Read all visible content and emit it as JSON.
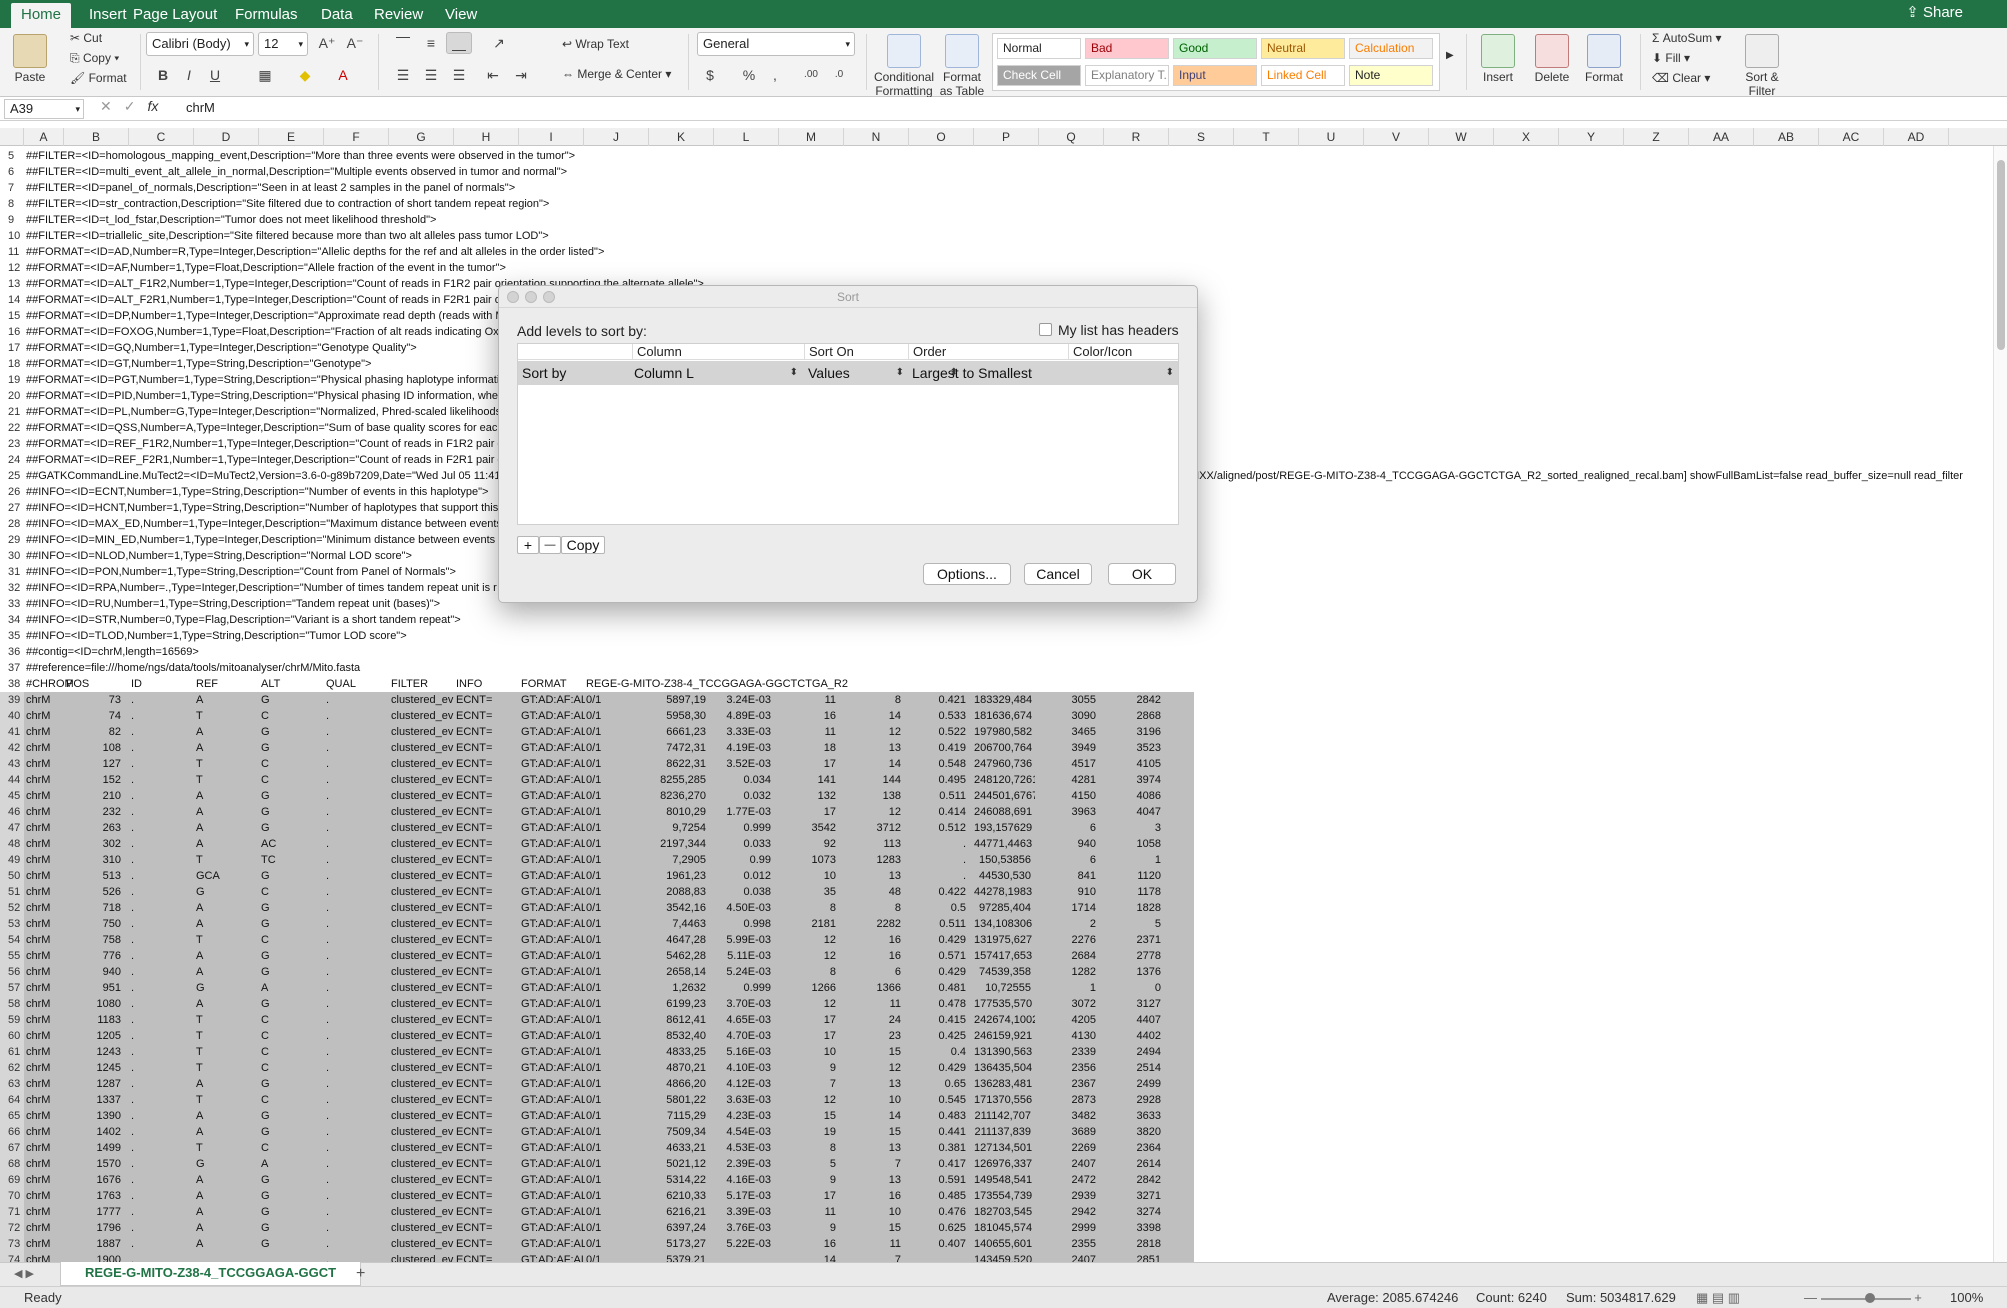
{
  "tabs": [
    "Home",
    "Insert",
    "Page Layout",
    "Formulas",
    "Data",
    "Review",
    "View"
  ],
  "share": "Share",
  "ribbon": {
    "paste": "Paste",
    "cut": "Cut",
    "copy": "Copy",
    "format": "Format",
    "font": "Calibri (Body)",
    "size": "12",
    "bold": "B",
    "italic": "I",
    "underline": "U",
    "wrap": "Wrap Text",
    "merge": "Merge & Center",
    "numfmt": "General",
    "cond": [
      "Conditional",
      "Formatting"
    ],
    "fat": [
      "Format",
      "as Table"
    ],
    "styles": [
      {
        "label": "Normal",
        "bg": "#ffffff",
        "fg": "#222222"
      },
      {
        "label": "Bad",
        "bg": "#ffc7ce",
        "fg": "#9c0006"
      },
      {
        "label": "Good",
        "bg": "#c6efce",
        "fg": "#006100"
      },
      {
        "label": "Neutral",
        "bg": "#ffeb9c",
        "fg": "#9c5700"
      },
      {
        "label": "Calculation",
        "bg": "#f2f2f2",
        "fg": "#fa7d00"
      },
      {
        "label": "Check Cell",
        "bg": "#a5a5a5",
        "fg": "#ffffff"
      },
      {
        "label": "Explanatory T...",
        "bg": "#ffffff",
        "fg": "#7f7f7f"
      },
      {
        "label": "Input",
        "bg": "#ffcc99",
        "fg": "#3f3f76"
      },
      {
        "label": "Linked Cell",
        "bg": "#ffffff",
        "fg": "#fa7d00"
      },
      {
        "label": "Note",
        "bg": "#ffffcc",
        "fg": "#222222"
      }
    ],
    "insert": "Insert",
    "delete": "Delete",
    "formatcells": "Format",
    "autosum": "AutoSum",
    "fill": "Fill",
    "clear": "Clear",
    "sortfilter": [
      "Sort &",
      "Filter"
    ]
  },
  "namebox": "A39",
  "fx": "fx",
  "formula": "chrM",
  "columns": [
    "A",
    "B",
    "C",
    "D",
    "E",
    "F",
    "G",
    "H",
    "I",
    "J",
    "K",
    "L",
    "M",
    "N",
    "O",
    "P",
    "Q",
    "R",
    "S",
    "T",
    "U",
    "V",
    "W",
    "X",
    "Y",
    "Z",
    "AA",
    "AB",
    "AC",
    "AD"
  ],
  "header_lines": [
    {
      "n": "5",
      "t": "##FILTER=<ID=homologous_mapping_event,Description=\"More than three events were observed in the tumor\">"
    },
    {
      "n": "6",
      "t": "##FILTER=<ID=multi_event_alt_allele_in_normal,Description=\"Multiple events observed in tumor and normal\">"
    },
    {
      "n": "7",
      "t": "##FILTER=<ID=panel_of_normals,Description=\"Seen in at least 2 samples in the panel of normals\">"
    },
    {
      "n": "8",
      "t": "##FILTER=<ID=str_contraction,Description=\"Site filtered due to contraction of short tandem repeat region\">"
    },
    {
      "n": "9",
      "t": "##FILTER=<ID=t_lod_fstar,Description=\"Tumor does not meet likelihood threshold\">"
    },
    {
      "n": "10",
      "t": "##FILTER=<ID=triallelic_site,Description=\"Site filtered because more than two alt alleles pass tumor LOD\">"
    },
    {
      "n": "11",
      "t": "##FORMAT=<ID=AD,Number=R,Type=Integer,Description=\"Allelic depths for the ref and alt alleles in the order listed\">"
    },
    {
      "n": "12",
      "t": "##FORMAT=<ID=AF,Number=1,Type=Float,Description=\"Allele fraction of the event in the tumor\">"
    },
    {
      "n": "13",
      "t": "##FORMAT=<ID=ALT_F1R2,Number=1,Type=Integer,Description=\"Count of reads in F1R2 pair orientation supporting the alternate allele\">"
    },
    {
      "n": "14",
      "t": "##FORMAT=<ID=ALT_F2R1,Number=1,Type=Integer,Description=\"Count of reads in F2R1 pair or"
    },
    {
      "n": "15",
      "t": "##FORMAT=<ID=DP,Number=1,Type=Integer,Description=\"Approximate read depth (reads with M"
    },
    {
      "n": "16",
      "t": "##FORMAT=<ID=FOXOG,Number=1,Type=Float,Description=\"Fraction of alt reads indicating Oxo"
    },
    {
      "n": "17",
      "t": "##FORMAT=<ID=GQ,Number=1,Type=Integer,Description=\"Genotype Quality\">"
    },
    {
      "n": "18",
      "t": "##FORMAT=<ID=GT,Number=1,Type=String,Description=\"Genotype\">"
    },
    {
      "n": "19",
      "t": "##FORMAT=<ID=PGT,Number=1,Type=String,Description=\"Physical phasing haplotype informati"
    },
    {
      "n": "20",
      "t": "##FORMAT=<ID=PID,Number=1,Type=String,Description=\"Physical phasing ID information, wher"
    },
    {
      "n": "21",
      "t": "##FORMAT=<ID=PL,Number=G,Type=Integer,Description=\"Normalized, Phred-scaled likelihoods"
    },
    {
      "n": "22",
      "t": "##FORMAT=<ID=QSS,Number=A,Type=Integer,Description=\"Sum of base quality scores for each"
    },
    {
      "n": "23",
      "t": "##FORMAT=<ID=REF_F1R2,Number=1,Type=Integer,Description=\"Count of reads in F1R2 pair or"
    },
    {
      "n": "24",
      "t": "##FORMAT=<ID=REF_F2R1,Number=1,Type=Integer,Description=\"Count of reads in F2R1 pair or"
    },
    {
      "n": "25",
      "t": "##GATKCommandLine.MuTect2=<ID=MuTect2,Version=3.6-0-g89b7209,Date=\"Wed Jul 05 11:41:"
    },
    {
      "n": "26",
      "t": "##INFO=<ID=ECNT,Number=1,Type=String,Description=\"Number of events in this haplotype\">"
    },
    {
      "n": "27",
      "t": "##INFO=<ID=HCNT,Number=1,Type=String,Description=\"Number of haplotypes that support this"
    },
    {
      "n": "28",
      "t": "##INFO=<ID=MAX_ED,Number=1,Type=Integer,Description=\"Maximum distance between events"
    },
    {
      "n": "29",
      "t": "##INFO=<ID=MIN_ED,Number=1,Type=Integer,Description=\"Minimum distance between events"
    },
    {
      "n": "30",
      "t": "##INFO=<ID=NLOD,Number=1,Type=String,Description=\"Normal LOD score\">"
    },
    {
      "n": "31",
      "t": "##INFO=<ID=PON,Number=1,Type=String,Description=\"Count from Panel of Normals\">"
    },
    {
      "n": "32",
      "t": "##INFO=<ID=RPA,Number=.,Type=Integer,Description=\"Number of times tandem repeat unit is r"
    },
    {
      "n": "33",
      "t": "##INFO=<ID=RU,Number=1,Type=String,Description=\"Tandem repeat unit (bases)\">"
    },
    {
      "n": "34",
      "t": "##INFO=<ID=STR,Number=0,Type=Flag,Description=\"Variant is a short tandem repeat\">"
    },
    {
      "n": "35",
      "t": "##INFO=<ID=TLOD,Number=1,Type=String,Description=\"Tumor LOD score\">"
    },
    {
      "n": "36",
      "t": "##contig=<ID=chrM,length=16569>"
    },
    {
      "n": "37",
      "t": "##reference=file:///home/ngs/data/tools/mitoanalyser/chrM/Mito.fasta"
    }
  ],
  "row25_tail": "ACB9CMANXX/aligned/post/REGE-G-MITO-Z38-4_TCCGGAGA-GGCTCTGA_R2_sorted_realigned_recal.bam] showFullBamList=false read_buffer_size=null read_filter",
  "table_header": {
    "n": "38",
    "cells": [
      "#CHROM",
      "POS",
      "ID",
      "REF",
      "ALT",
      "QUAL",
      "FILTER",
      "INFO",
      "FORMAT",
      "REGE-G-MITO-Z38-4_TCCGGAGA-GGCTCTGA_R2"
    ]
  },
  "rows": [
    {
      "n": "39",
      "pos": "73",
      "ref": "A",
      "alt": "G",
      "j": "5897,19",
      "k": "3.24E-03",
      "l": "11",
      "m": "8",
      "n2": "0.421",
      "o": "183329,484",
      "p": "3055",
      "q": "2842"
    },
    {
      "n": "40",
      "pos": "74",
      "ref": "T",
      "alt": "C",
      "j": "5958,30",
      "k": "4.89E-03",
      "l": "16",
      "m": "14",
      "n2": "0.533",
      "o": "181636,674",
      "p": "3090",
      "q": "2868"
    },
    {
      "n": "41",
      "pos": "82",
      "ref": "A",
      "alt": "G",
      "j": "6661,23",
      "k": "3.33E-03",
      "l": "11",
      "m": "12",
      "n2": "0.522",
      "o": "197980,582",
      "p": "3465",
      "q": "3196"
    },
    {
      "n": "42",
      "pos": "108",
      "ref": "A",
      "alt": "G",
      "j": "7472,31",
      "k": "4.19E-03",
      "l": "18",
      "m": "13",
      "n2": "0.419",
      "o": "206700,764",
      "p": "3949",
      "q": "3523"
    },
    {
      "n": "43",
      "pos": "127",
      "ref": "T",
      "alt": "C",
      "j": "8622,31",
      "k": "3.52E-03",
      "l": "17",
      "m": "14",
      "n2": "0.548",
      "o": "247960,736",
      "p": "4517",
      "q": "4105"
    },
    {
      "n": "44",
      "pos": "152",
      "ref": "T",
      "alt": "C",
      "j": "8255,285",
      "k": "0.034",
      "l": "141",
      "m": "144",
      "n2": "0.495",
      "o": "248120,7261",
      "p": "4281",
      "q": "3974"
    },
    {
      "n": "45",
      "pos": "210",
      "ref": "A",
      "alt": "G",
      "j": "8236,270",
      "k": "0.032",
      "l": "132",
      "m": "138",
      "n2": "0.511",
      "o": "244501,6767",
      "p": "4150",
      "q": "4086"
    },
    {
      "n": "46",
      "pos": "232",
      "ref": "A",
      "alt": "G",
      "j": "8010,29",
      "k": "1.77E-03",
      "l": "17",
      "m": "12",
      "n2": "0.414",
      "o": "246088,691",
      "p": "3963",
      "q": "4047"
    },
    {
      "n": "47",
      "pos": "263",
      "ref": "A",
      "alt": "G",
      "j": "9,7254",
      "k": "0.999",
      "l": "3542",
      "m": "3712",
      "n2": "0.512",
      "o": "193,157629",
      "p": "6",
      "q": "3"
    },
    {
      "n": "48",
      "pos": "302",
      "ref": "A",
      "alt": "AC",
      "j": "2197,344",
      "k": "0.033",
      "l": "92",
      "m": "113",
      "n2": ".",
      "o": "44771,4463",
      "p": "940",
      "q": "1058"
    },
    {
      "n": "49",
      "pos": "310",
      "ref": "T",
      "alt": "TC",
      "j": "7,2905",
      "k": "0.99",
      "l": "1073",
      "m": "1283",
      "n2": ".",
      "o": "150,53856",
      "p": "6",
      "q": "1"
    },
    {
      "n": "50",
      "pos": "513",
      "ref": "GCA",
      "alt": "G",
      "j": "1961,23",
      "k": "0.012",
      "l": "10",
      "m": "13",
      "n2": ".",
      "o": "44530,530",
      "p": "841",
      "q": "1120"
    },
    {
      "n": "51",
      "pos": "526",
      "ref": "G",
      "alt": "C",
      "j": "2088,83",
      "k": "0.038",
      "l": "35",
      "m": "48",
      "n2": "0.422",
      "o": "44278,1983",
      "p": "910",
      "q": "1178"
    },
    {
      "n": "52",
      "pos": "718",
      "ref": "A",
      "alt": "G",
      "j": "3542,16",
      "k": "4.50E-03",
      "l": "8",
      "m": "8",
      "n2": "0.5",
      "o": "97285,404",
      "p": "1714",
      "q": "1828"
    },
    {
      "n": "53",
      "pos": "750",
      "ref": "A",
      "alt": "G",
      "j": "7,4463",
      "k": "0.998",
      "l": "2181",
      "m": "2282",
      "n2": "0.511",
      "o": "134,108306",
      "p": "2",
      "q": "5"
    },
    {
      "n": "54",
      "pos": "758",
      "ref": "T",
      "alt": "C",
      "j": "4647,28",
      "k": "5.99E-03",
      "l": "12",
      "m": "16",
      "n2": "0.429",
      "o": "131975,627",
      "p": "2276",
      "q": "2371"
    },
    {
      "n": "55",
      "pos": "776",
      "ref": "A",
      "alt": "G",
      "j": "5462,28",
      "k": "5.11E-03",
      "l": "12",
      "m": "16",
      "n2": "0.571",
      "o": "157417,653",
      "p": "2684",
      "q": "2778"
    },
    {
      "n": "56",
      "pos": "940",
      "ref": "A",
      "alt": "G",
      "j": "2658,14",
      "k": "5.24E-03",
      "l": "8",
      "m": "6",
      "n2": "0.429",
      "o": "74539,358",
      "p": "1282",
      "q": "1376"
    },
    {
      "n": "57",
      "pos": "951",
      "ref": "G",
      "alt": "A",
      "j": "1,2632",
      "k": "0.999",
      "l": "1266",
      "m": "1366",
      "n2": "0.481",
      "o": "10,72555",
      "p": "1",
      "q": "0"
    },
    {
      "n": "58",
      "pos": "1080",
      "ref": "A",
      "alt": "G",
      "j": "6199,23",
      "k": "3.70E-03",
      "l": "12",
      "m": "11",
      "n2": "0.478",
      "o": "177535,570",
      "p": "3072",
      "q": "3127"
    },
    {
      "n": "59",
      "pos": "1183",
      "ref": "T",
      "alt": "C",
      "j": "8612,41",
      "k": "4.65E-03",
      "l": "17",
      "m": "24",
      "n2": "0.415",
      "o": "242674,1002",
      "p": "4205",
      "q": "4407"
    },
    {
      "n": "60",
      "pos": "1205",
      "ref": "T",
      "alt": "C",
      "j": "8532,40",
      "k": "4.70E-03",
      "l": "17",
      "m": "23",
      "n2": "0.425",
      "o": "246159,921",
      "p": "4130",
      "q": "4402"
    },
    {
      "n": "61",
      "pos": "1243",
      "ref": "T",
      "alt": "C",
      "j": "4833,25",
      "k": "5.16E-03",
      "l": "10",
      "m": "15",
      "n2": "0.4",
      "o": "131390,563",
      "p": "2339",
      "q": "2494"
    },
    {
      "n": "62",
      "pos": "1245",
      "ref": "T",
      "alt": "C",
      "j": "4870,21",
      "k": "4.10E-03",
      "l": "9",
      "m": "12",
      "n2": "0.429",
      "o": "136435,504",
      "p": "2356",
      "q": "2514"
    },
    {
      "n": "63",
      "pos": "1287",
      "ref": "A",
      "alt": "G",
      "j": "4866,20",
      "k": "4.12E-03",
      "l": "7",
      "m": "13",
      "n2": "0.65",
      "o": "136283,481",
      "p": "2367",
      "q": "2499"
    },
    {
      "n": "64",
      "pos": "1337",
      "ref": "T",
      "alt": "C",
      "j": "5801,22",
      "k": "3.63E-03",
      "l": "12",
      "m": "10",
      "n2": "0.545",
      "o": "171370,556",
      "p": "2873",
      "q": "2928"
    },
    {
      "n": "65",
      "pos": "1390",
      "ref": "A",
      "alt": "G",
      "j": "7115,29",
      "k": "4.23E-03",
      "l": "15",
      "m": "14",
      "n2": "0.483",
      "o": "211142,707",
      "p": "3482",
      "q": "3633"
    },
    {
      "n": "66",
      "pos": "1402",
      "ref": "A",
      "alt": "G",
      "j": "7509,34",
      "k": "4.54E-03",
      "l": "19",
      "m": "15",
      "n2": "0.441",
      "o": "211137,839",
      "p": "3689",
      "q": "3820"
    },
    {
      "n": "67",
      "pos": "1499",
      "ref": "T",
      "alt": "C",
      "j": "4633,21",
      "k": "4.53E-03",
      "l": "8",
      "m": "13",
      "n2": "0.381",
      "o": "127134,501",
      "p": "2269",
      "q": "2364"
    },
    {
      "n": "68",
      "pos": "1570",
      "ref": "G",
      "alt": "A",
      "j": "5021,12",
      "k": "2.39E-03",
      "l": "5",
      "m": "7",
      "n2": "0.417",
      "o": "126976,337",
      "p": "2407",
      "q": "2614"
    },
    {
      "n": "69",
      "pos": "1676",
      "ref": "A",
      "alt": "G",
      "j": "5314,22",
      "k": "4.16E-03",
      "l": "9",
      "m": "13",
      "n2": "0.591",
      "o": "149548,541",
      "p": "2472",
      "q": "2842"
    },
    {
      "n": "70",
      "pos": "1763",
      "ref": "A",
      "alt": "G",
      "j": "6210,33",
      "k": "5.17E-03",
      "l": "17",
      "m": "16",
      "n2": "0.485",
      "o": "173554,739",
      "p": "2939",
      "q": "3271"
    },
    {
      "n": "71",
      "pos": "1777",
      "ref": "A",
      "alt": "G",
      "j": "6216,21",
      "k": "3.39E-03",
      "l": "11",
      "m": "10",
      "n2": "0.476",
      "o": "182703,545",
      "p": "2942",
      "q": "3274"
    },
    {
      "n": "72",
      "pos": "1796",
      "ref": "A",
      "alt": "G",
      "j": "6397,24",
      "k": "3.76E-03",
      "l": "9",
      "m": "15",
      "n2": "0.625",
      "o": "181045,574",
      "p": "2999",
      "q": "3398"
    },
    {
      "n": "73",
      "pos": "1887",
      "ref": "A",
      "alt": "G",
      "j": "5173,27",
      "k": "5.22E-03",
      "l": "16",
      "m": "11",
      "n2": "0.407",
      "o": "140655,601",
      "p": "2355",
      "q": "2818"
    },
    {
      "n": "74",
      "pos": "1900",
      "ref": "",
      "alt": "",
      "j": "5379,21",
      "k": "",
      "l": "14",
      "m": "7",
      "n2": "",
      "o": "143459,520",
      "p": "2407",
      "q": "2851"
    }
  ],
  "row_const": {
    "chrom": "chrM",
    "id": ".",
    "qual": ".",
    "filter": "clustered_ev",
    "info_prefix": "ECNT=",
    "format": "GT:AD:AF:AL",
    "gt": "0/1"
  },
  "dialog": {
    "title": "Sort",
    "add_levels": "Add levels to sort by:",
    "headers_chk": "My list has headers",
    "cols": [
      "Column",
      "Sort On",
      "Order",
      "Color/Icon"
    ],
    "row": {
      "label": "Sort by",
      "column": "Column L",
      "sort_on": "Values",
      "order": "Largest to Smallest"
    },
    "plus": "+",
    "minus": "—",
    "copy": "Copy",
    "options": "Options...",
    "cancel": "Cancel",
    "ok": "OK"
  },
  "sheet_tab": "REGE-G-MITO-Z38-4_TCCGGAGA-GGCT",
  "add_sheet": "+",
  "status": {
    "ready": "Ready",
    "average": "Average: 2085.674246",
    "count": "Count: 6240",
    "sum": "Sum: 5034817.629",
    "zoom": "100%"
  }
}
